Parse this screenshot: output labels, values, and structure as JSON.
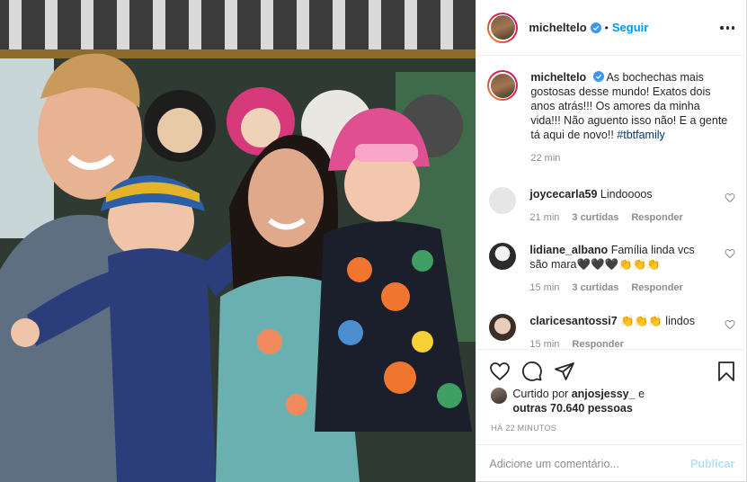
{
  "post": {
    "username": "micheltelo",
    "follow_label": "Seguir",
    "dot": "•"
  },
  "caption": {
    "username": "micheltelo",
    "text": "As bochechas mais gostosas desse mundo! Exatos dois anos atrás!!! Os amores da minha vida!!! Não aguento isso não! E a gente tá aqui de novo!!",
    "hashtag": "#tbtfamily",
    "time": "22 min"
  },
  "comments": [
    {
      "username": "joycecarla59",
      "text": "Lindoooos",
      "time": "21 min",
      "likes": "3 curtidas",
      "reply": "Responder",
      "avatar_color": "#e6e6e6"
    },
    {
      "username": "lidiane_albano",
      "text": "Família linda vcs são mara🖤🖤🖤👏👏👏",
      "time": "15 min",
      "likes": "3 curtidas",
      "reply": "Responder",
      "avatar_color": "#2b2b2b"
    },
    {
      "username": "claricesantossi7",
      "text": "👏👏👏 lindos",
      "time": "15 min",
      "likes": "",
      "reply": "Responder",
      "avatar_color": "#c9b7a9"
    }
  ],
  "likes": {
    "prefix": "Curtido por",
    "user": "anjosjessy_",
    "middle": "e",
    "others": "outras 70.640 pessoas"
  },
  "posted_ago": "HÁ 22 MINUTOS",
  "add_comment": {
    "placeholder": "Adicione um comentário...",
    "publish_label": "Publicar"
  },
  "icons": [
    "verified-icon",
    "more-options-icon",
    "heart-icon",
    "comment-icon",
    "share-icon",
    "bookmark-icon"
  ],
  "colors": {
    "link_blue": "#0095f6",
    "publish_disabled": "#b2dffc",
    "muted": "#8e8e8e"
  }
}
